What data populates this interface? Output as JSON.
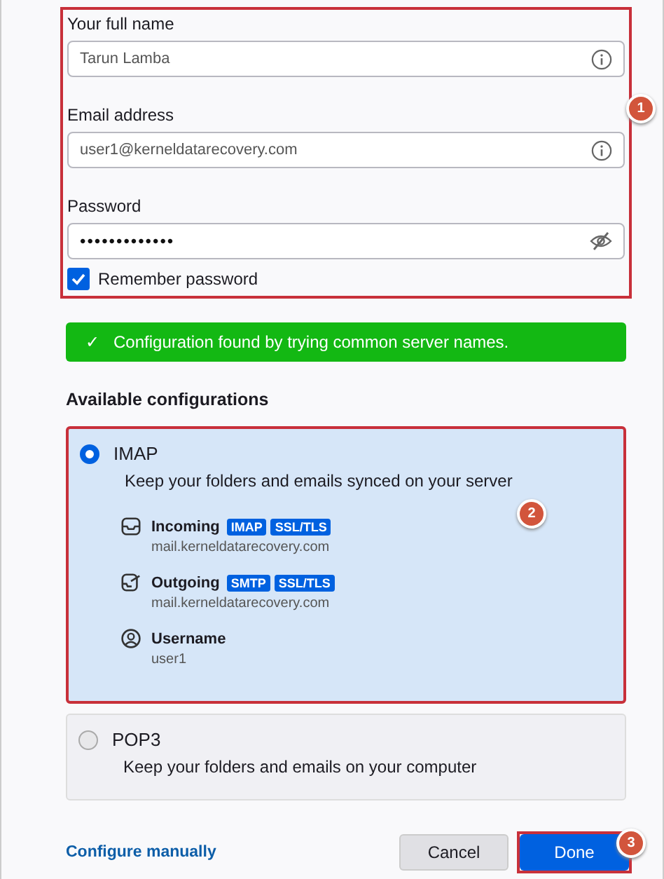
{
  "account": {
    "annotation": "1",
    "fields": [
      {
        "kind": "info",
        "label": "Your full name",
        "value": "Tarun Lamba"
      },
      {
        "kind": "info",
        "label": "Email address",
        "value": "user1@kerneldatarecovery.com"
      },
      {
        "kind": "password",
        "label": "Password",
        "value": "•••••••••••••"
      }
    ],
    "remember_password": {
      "label": "Remember password",
      "checked": true
    }
  },
  "status_banner": {
    "icon": "✓",
    "message": "Configuration found by trying common server names."
  },
  "configurations": {
    "heading": "Available configurations",
    "annotation": "2",
    "options": [
      {
        "label": "IMAP",
        "description": "Keep your folders and emails synced on your server",
        "selected": true,
        "details": [
          {
            "kind": "incoming",
            "title": "Incoming",
            "tags": [
              "IMAP",
              "SSL/TLS"
            ],
            "value": "mail.kerneldatarecovery.com"
          },
          {
            "kind": "outgoing",
            "title": "Outgoing",
            "tags": [
              "SMTP",
              "SSL/TLS"
            ],
            "value": "mail.kerneldatarecovery.com"
          },
          {
            "kind": "user",
            "title": "Username",
            "value": "user1"
          }
        ]
      },
      {
        "label": "POP3",
        "description": "Keep your folders and emails on your computer",
        "selected": false
      }
    ]
  },
  "footer": {
    "link": "Configure manually",
    "buttons": [
      {
        "kind": "secondary",
        "label": "Cancel"
      },
      {
        "kind": "primary",
        "label": "Done",
        "annotation": "3"
      }
    ]
  }
}
